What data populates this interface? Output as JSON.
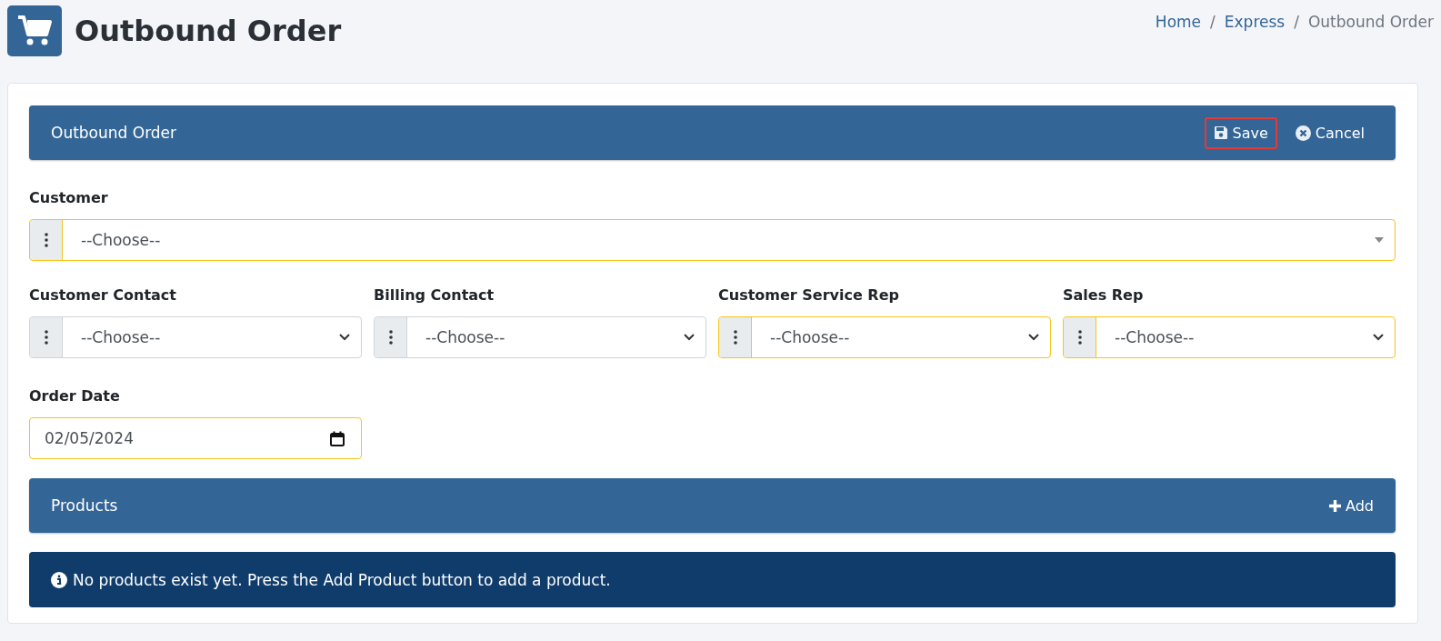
{
  "page": {
    "title": "Outbound Order"
  },
  "breadcrumb_separator": "/",
  "breadcrumb": [
    {
      "label": "Home",
      "current": false
    },
    {
      "label": "Express",
      "current": false
    },
    {
      "label": "Outbound Order",
      "current": true
    }
  ],
  "order_panel": {
    "title": "Outbound Order",
    "actions": [
      {
        "kind": "save",
        "label": "Save",
        "highlighted": true
      },
      {
        "kind": "cancel",
        "label": "Cancel",
        "highlighted": false
      }
    ]
  },
  "customer": {
    "label": "Customer",
    "value": "--Choose--",
    "required": true
  },
  "contact_fields": [
    {
      "label": "Customer Contact",
      "value": "--Choose--",
      "required": false
    },
    {
      "label": "Billing Contact",
      "value": "--Choose--",
      "required": false
    },
    {
      "label": "Customer Service Rep",
      "value": "--Choose--",
      "required": true
    },
    {
      "label": "Sales Rep",
      "value": "--Choose--",
      "required": true
    }
  ],
  "order_date": {
    "label": "Order Date",
    "value": "02/05/2024",
    "required": true
  },
  "products_panel": {
    "title": "Products",
    "add_label": "Add"
  },
  "products_alert": {
    "message": "No products exist yet. Press the Add Product button to add a product."
  }
}
